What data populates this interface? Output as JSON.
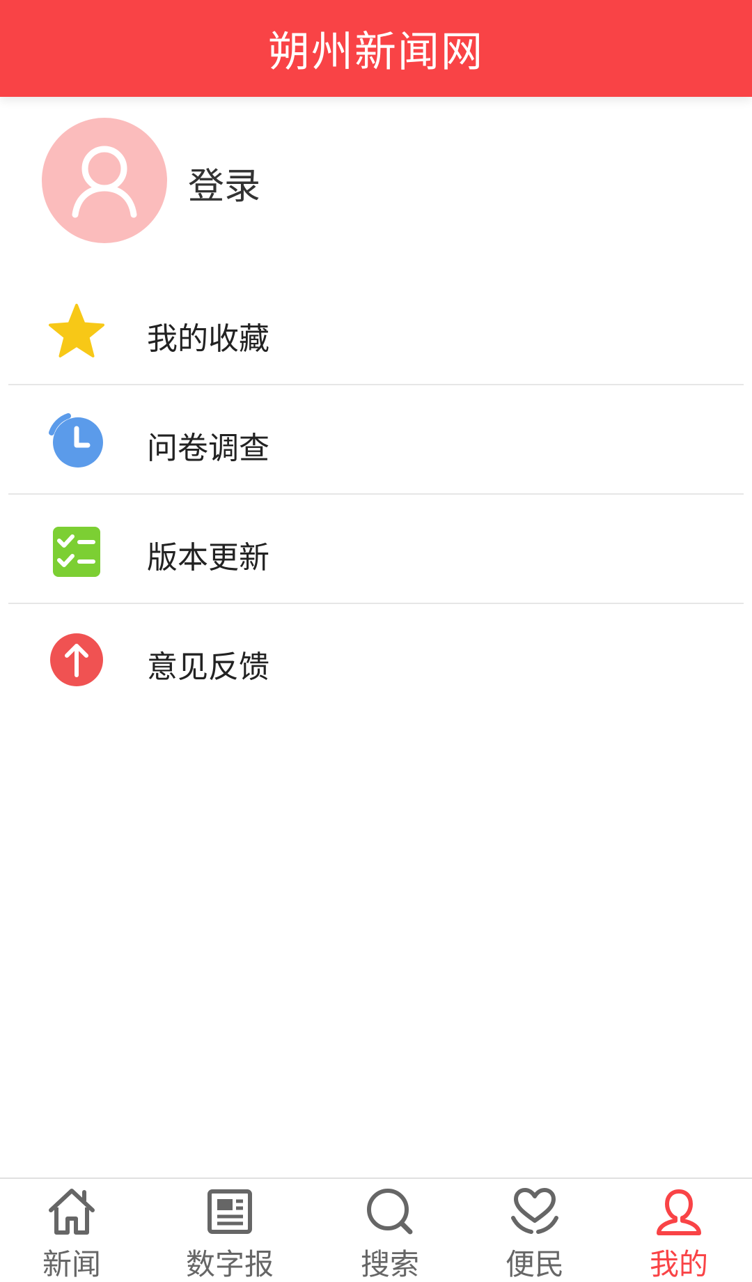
{
  "header": {
    "title": "朔州新闻网"
  },
  "profile": {
    "login_label": "登录"
  },
  "menu": [
    {
      "label": "我的收藏",
      "icon": "star-icon",
      "color": "#f7c817"
    },
    {
      "label": "问卷调查",
      "icon": "clock-icon",
      "color": "#5b9bea"
    },
    {
      "label": "版本更新",
      "icon": "checklist-icon",
      "color": "#7ccf33"
    },
    {
      "label": "意见反馈",
      "icon": "upload-arrow-icon",
      "color": "#f05252"
    }
  ],
  "tabs": [
    {
      "label": "新闻",
      "icon": "home-icon",
      "active": false
    },
    {
      "label": "数字报",
      "icon": "newspaper-icon",
      "active": false
    },
    {
      "label": "搜索",
      "icon": "search-icon",
      "active": false
    },
    {
      "label": "便民",
      "icon": "heart-hands-icon",
      "active": false
    },
    {
      "label": "我的",
      "icon": "user-icon",
      "active": true
    }
  ],
  "colors": {
    "brand": "#f94346",
    "avatar_bg": "#fbbcbc",
    "tab_inactive": "#666666"
  }
}
